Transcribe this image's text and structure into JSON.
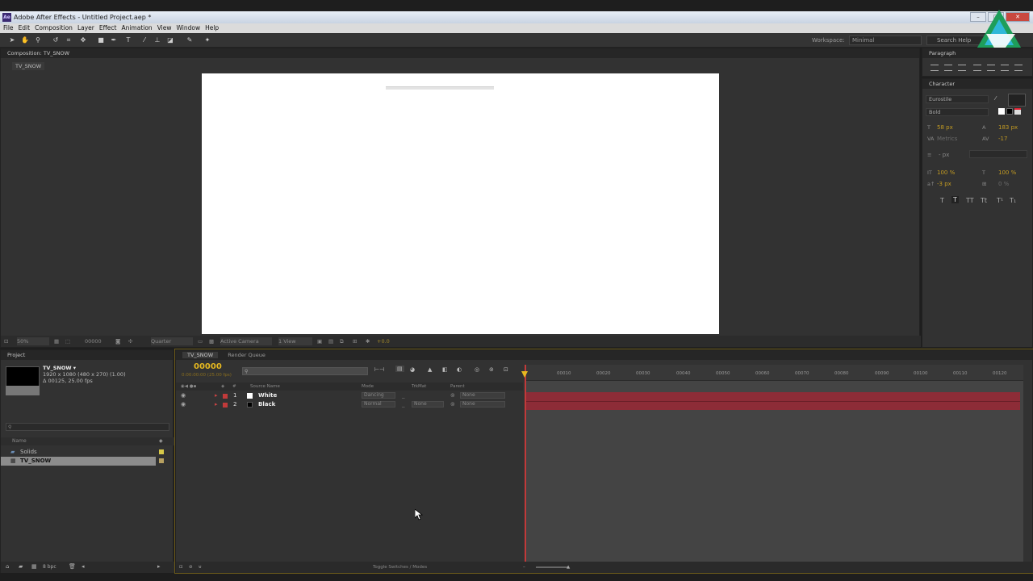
{
  "window": {
    "title": "Adobe After Effects - Untitled Project.aep *",
    "app_icon": "Ae"
  },
  "menu": [
    "File",
    "Edit",
    "Composition",
    "Layer",
    "Effect",
    "Animation",
    "View",
    "Window",
    "Help"
  ],
  "toolbar": {
    "workspace_label": "Workspace:",
    "workspace_value": "Minimal",
    "search_placeholder": "Search Help"
  },
  "composition": {
    "tab": "Composition: TV_SNOW",
    "sub_tab": "TV_SNOW",
    "footer": {
      "zoom": "50%",
      "timecode": "00000",
      "resolution": "Quarter",
      "camera": "Active Camera",
      "views": "1 View",
      "exposure": "+0.0"
    }
  },
  "paragraph": {
    "tab": "Paragraph"
  },
  "character": {
    "tab": "Character",
    "font": "Eurostile",
    "style": "Bold",
    "size": "58 px",
    "leading": "183 px",
    "kerning": "Metrics",
    "tracking": "-17",
    "stroke_unit": "- px",
    "vscale": "100 %",
    "hscale": "100 %",
    "baseline": "-3 px",
    "tsume": "0 %"
  },
  "project": {
    "tab": "Project",
    "item_name": "TV_SNOW ▾",
    "item_size": "1920 x 1080  (480 x 270) (1.00)",
    "item_duration": "Δ 00125, 25.00 fps",
    "col_name": "Name",
    "items": [
      {
        "name": "Solids",
        "type": "folder"
      },
      {
        "name": "TV_SNOW",
        "type": "comp"
      }
    ],
    "bpc": "8 bpc"
  },
  "timeline": {
    "tab": "TV_SNOW",
    "tab2": "Render Queue",
    "timecode": "00000",
    "fps": "0:00:00:00 (25.00 fps)",
    "columns": {
      "source": "Source Name",
      "mode": "Mode",
      "trkmat": "TrkMat",
      "parent": "Parent"
    },
    "layers": [
      {
        "num": "1",
        "name": "White",
        "mode": "Dancing",
        "trkmat": "",
        "parent": "None",
        "swatch": "#ffffff"
      },
      {
        "num": "2",
        "name": "Black",
        "mode": "Normal",
        "trkmat": "None",
        "parent": "None",
        "swatch": "#000000"
      }
    ],
    "ruler": [
      "00010",
      "00020",
      "00030",
      "00040",
      "00050",
      "00060",
      "00070",
      "00080",
      "00090",
      "00100",
      "00110",
      "00120"
    ],
    "footer": "Toggle Switches / Modes",
    "layer_bar_color": "#8d2c37",
    "accent": "#e5b820"
  }
}
